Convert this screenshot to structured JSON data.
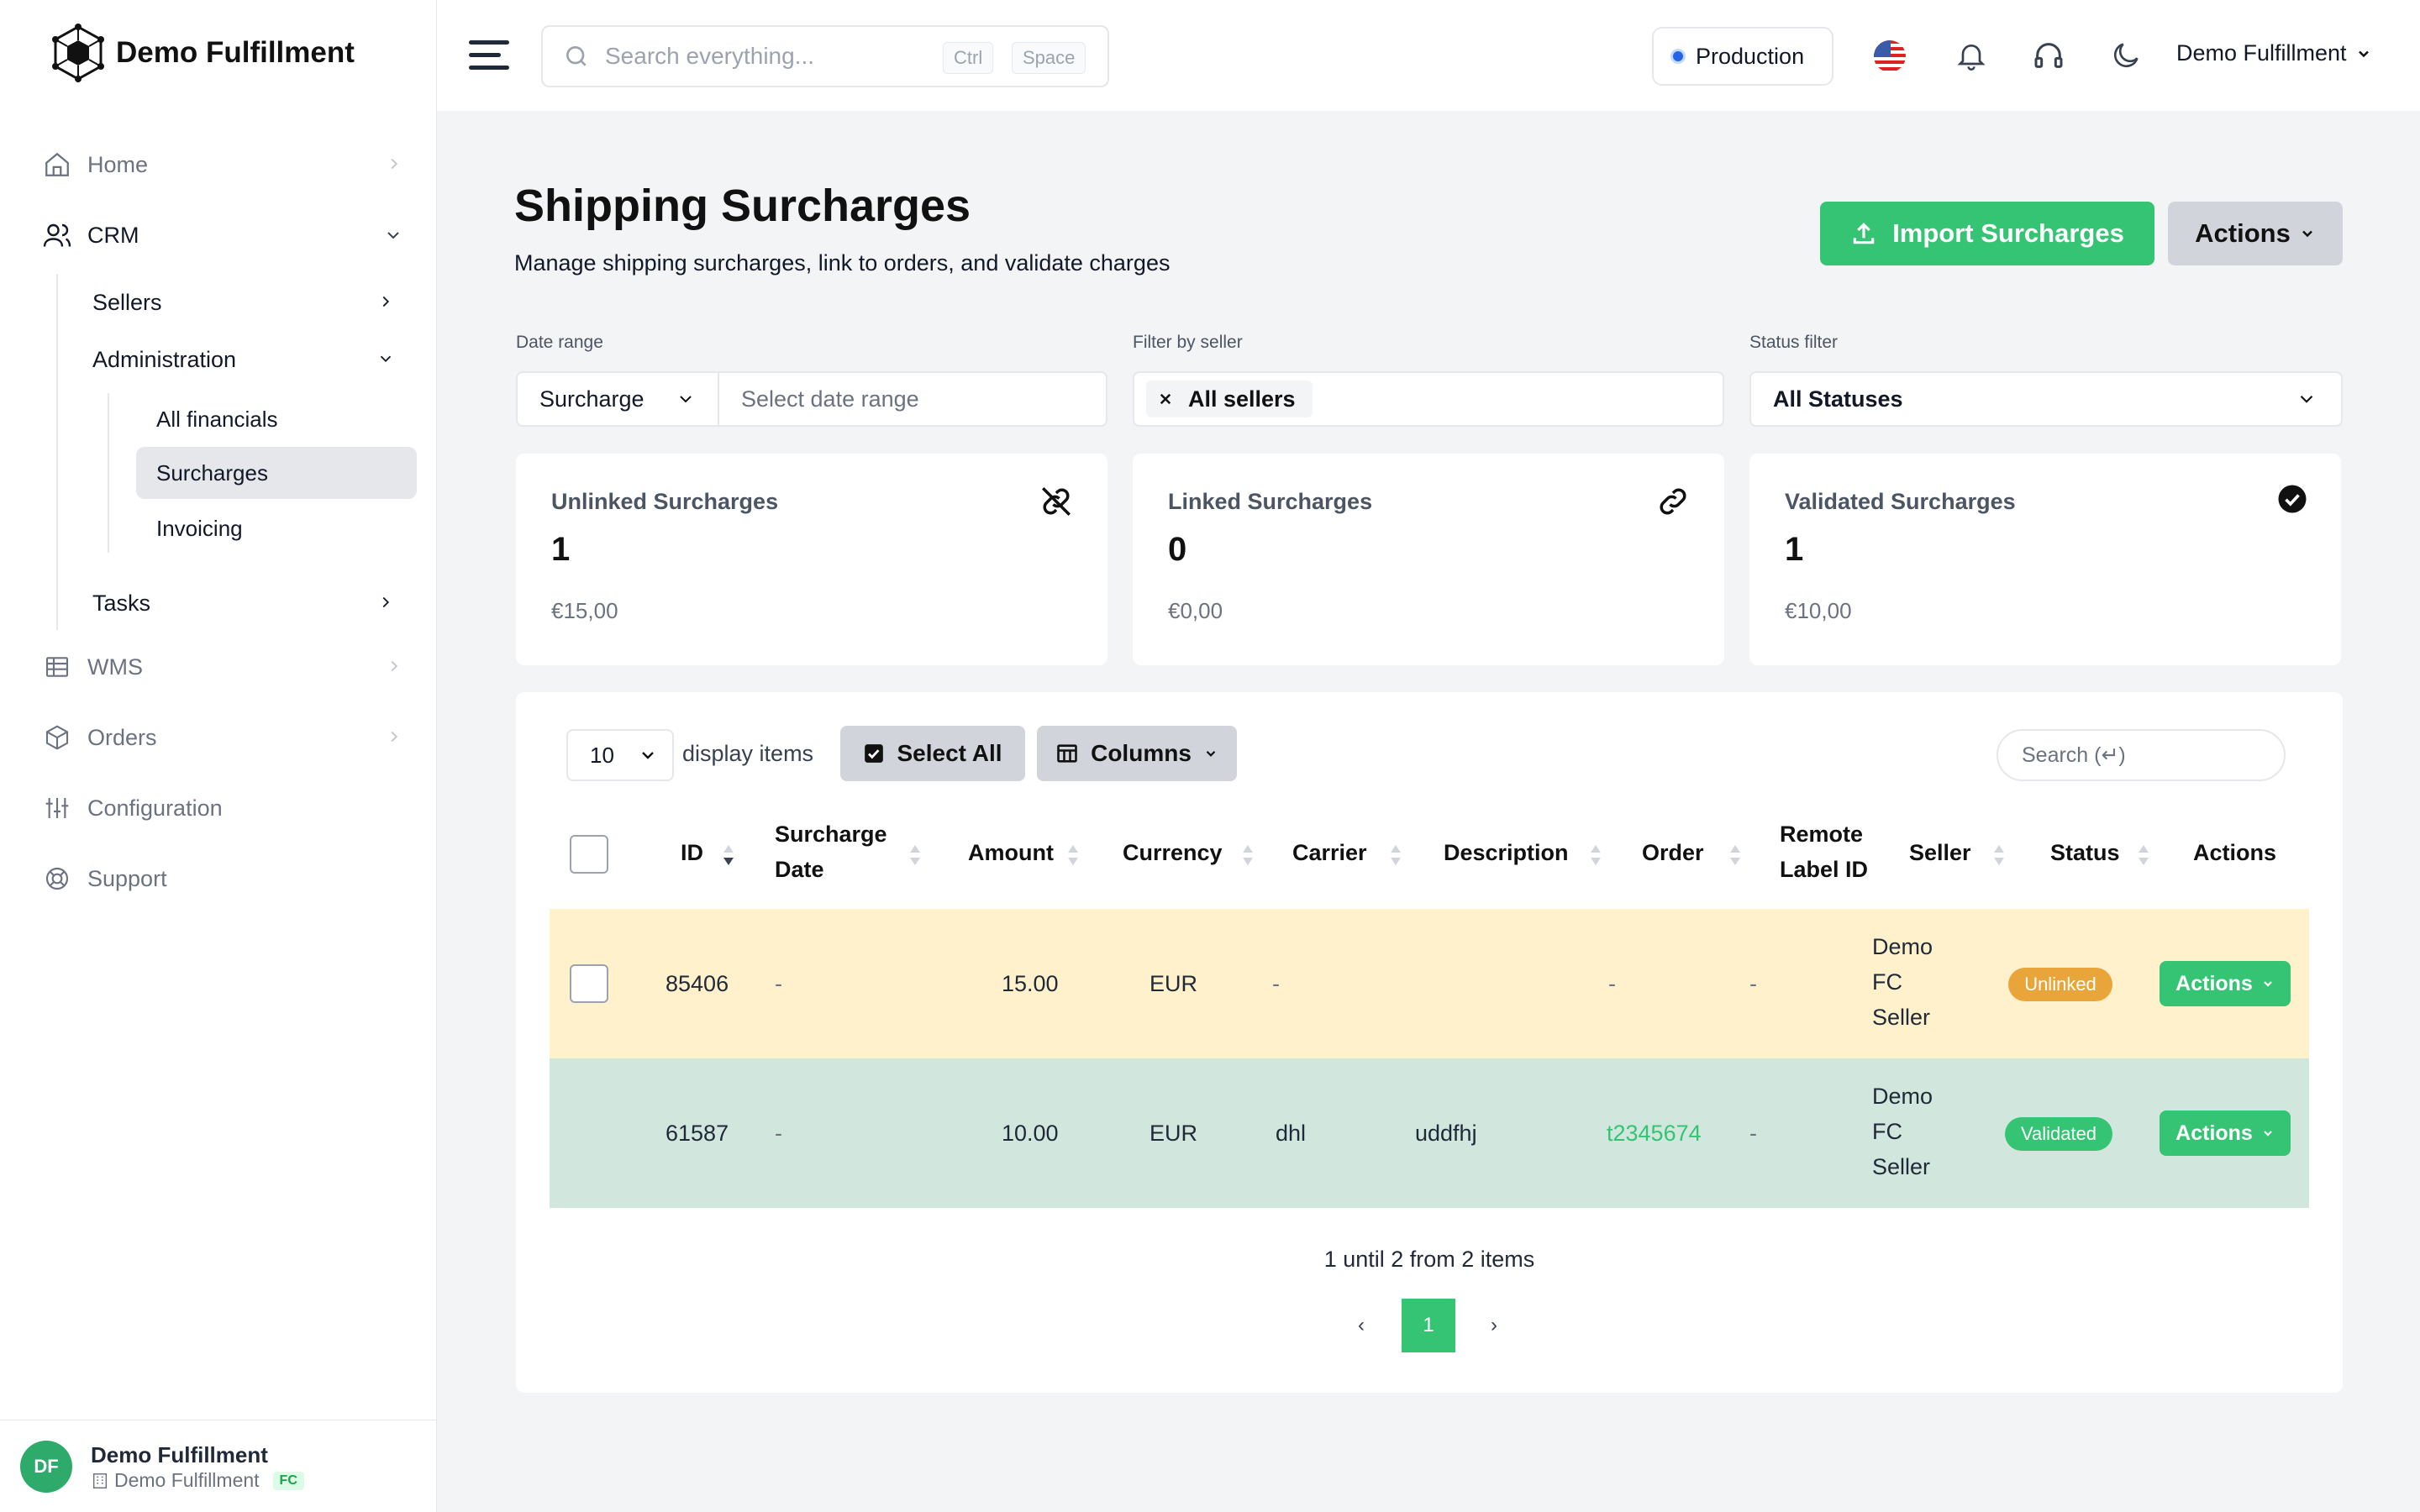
{
  "app": {
    "name": "Demo Fulfillment"
  },
  "sidebar": {
    "items": [
      {
        "label": "Home",
        "icon": "home-icon"
      },
      {
        "label": "CRM",
        "icon": "users-icon"
      },
      {
        "label": "WMS",
        "icon": "table-icon"
      },
      {
        "label": "Orders",
        "icon": "box-icon"
      },
      {
        "label": "Configuration",
        "icon": "sliders-icon"
      },
      {
        "label": "Support",
        "icon": "lifebuoy-icon"
      }
    ],
    "crm_sub": [
      {
        "label": "Sellers"
      },
      {
        "label": "Administration"
      },
      {
        "label": "Tasks"
      }
    ],
    "admin_sub": [
      {
        "label": "All financials"
      },
      {
        "label": "Surcharges"
      },
      {
        "label": "Invoicing"
      }
    ],
    "footer": {
      "initials": "DF",
      "name": "Demo Fulfillment",
      "org": "Demo Fulfillment",
      "badge": "FC"
    }
  },
  "header": {
    "search_placeholder": "Search everything...",
    "kbd1": "Ctrl",
    "kbd2": "Space",
    "environment": "Production",
    "user": "Demo Fulfillment"
  },
  "page": {
    "title": "Shipping Surcharges",
    "subtitle": "Manage shipping surcharges, link to orders, and validate charges",
    "import_button": "Import Surcharges",
    "actions_button": "Actions"
  },
  "filters": {
    "date_label": "Date range",
    "date_type": "Surcharge",
    "date_placeholder": "Select date range",
    "seller_label": "Filter by seller",
    "seller_value": "All sellers",
    "status_label": "Status filter",
    "status_value": "All Statuses"
  },
  "cards": [
    {
      "title": "Unlinked Surcharges",
      "count": "1",
      "amount": "€15,00"
    },
    {
      "title": "Linked Surcharges",
      "count": "0",
      "amount": "€0,00"
    },
    {
      "title": "Validated Surcharges",
      "count": "1",
      "amount": "€10,00"
    }
  ],
  "table": {
    "per_page": "10",
    "per_page_label": "display items",
    "select_all": "Select All",
    "columns_button": "Columns",
    "search_placeholder": "Search (↵)",
    "headers": {
      "id": "ID",
      "date1": "Surcharge",
      "date2": "Date",
      "amount": "Amount",
      "currency": "Currency",
      "carrier": "Carrier",
      "description": "Description",
      "order": "Order",
      "remote1": "Remote",
      "remote2": "Label ID",
      "seller": "Seller",
      "status": "Status",
      "actions": "Actions"
    },
    "rows": [
      {
        "id": "85406",
        "date": "-",
        "amount": "15.00",
        "currency": "EUR",
        "carrier": "-",
        "description": "",
        "order": "-",
        "remote": "-",
        "seller1": "Demo",
        "seller2": "FC",
        "seller3": "Seller",
        "status": "Unlinked",
        "action": "Actions",
        "bg": "#fef3cd",
        "status_color": "#e9a53a"
      },
      {
        "id": "61587",
        "date": "-",
        "amount": "10.00",
        "currency": "EUR",
        "carrier": "dhl",
        "description": "uddfhj",
        "order": "t2345674",
        "remote": "-",
        "seller1": "Demo",
        "seller2": "FC",
        "seller3": "Seller",
        "status": "Validated",
        "action": "Actions",
        "bg": "#d1e7dd",
        "status_color": "#34c473"
      }
    ],
    "pagination_text": "1 until 2 from 2 items",
    "current_page": "1",
    "prev": "‹",
    "next": "›"
  }
}
